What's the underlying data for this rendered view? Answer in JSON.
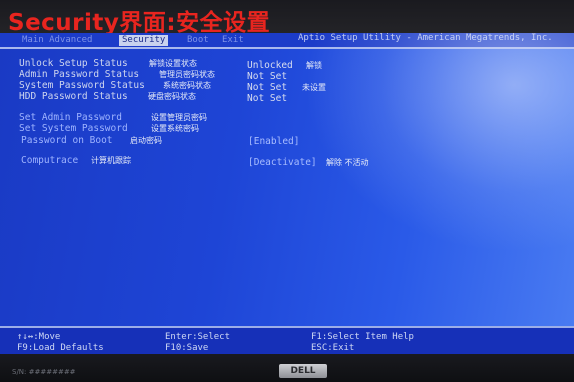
{
  "caption": "Security界面:安全设置",
  "tabs": [
    {
      "label": "Main  Advanced",
      "active": false
    },
    {
      "label": "Security",
      "active": true
    },
    {
      "label": "Boot",
      "active": false
    },
    {
      "label": "Exit",
      "active": false
    }
  ],
  "vendor": "Aptio Setup Utility - American Megatrends, Inc.",
  "rows": [
    {
      "label": "Unlock Setup Status",
      "annotation": "解锁设置状态",
      "value": "Unlocked",
      "value_annotation": "解锁"
    },
    {
      "label": "Admin Password Status",
      "annotation": "管理员密码状态",
      "value": "Not Set",
      "value_annotation": ""
    },
    {
      "label": "System Password Status",
      "annotation": "系统密码状态",
      "value": "Not Set",
      "value_annotation": "未设置"
    },
    {
      "label": "HDD Password Status",
      "annotation": "硬盘密码状态",
      "value": "Not Set",
      "value_annotation": ""
    },
    {
      "label": "Set Admin Password",
      "annotation": "设置管理员密码",
      "value": "",
      "value_annotation": ""
    },
    {
      "label": "Set System Password",
      "annotation": "设置系统密码",
      "value": "",
      "value_annotation": ""
    },
    {
      "label": "Password on Boot",
      "annotation": "启动密码",
      "value": "[Enabled]",
      "value_annotation": ""
    },
    {
      "label": "Computrace",
      "annotation": "计算机跟踪",
      "value": "[Deactivate]",
      "value_annotation": "解除 不活动"
    }
  ],
  "footer": {
    "select_item": "↑↓↔:Move",
    "load_defaults": "F9:Load Defaults",
    "enter_select": "Enter:Select",
    "save": "F10:Save",
    "help": "F1:Select Item Help",
    "exit": "ESC:Exit"
  },
  "bezel": {
    "sticker": "S/N: ########",
    "logo": "DELL"
  }
}
